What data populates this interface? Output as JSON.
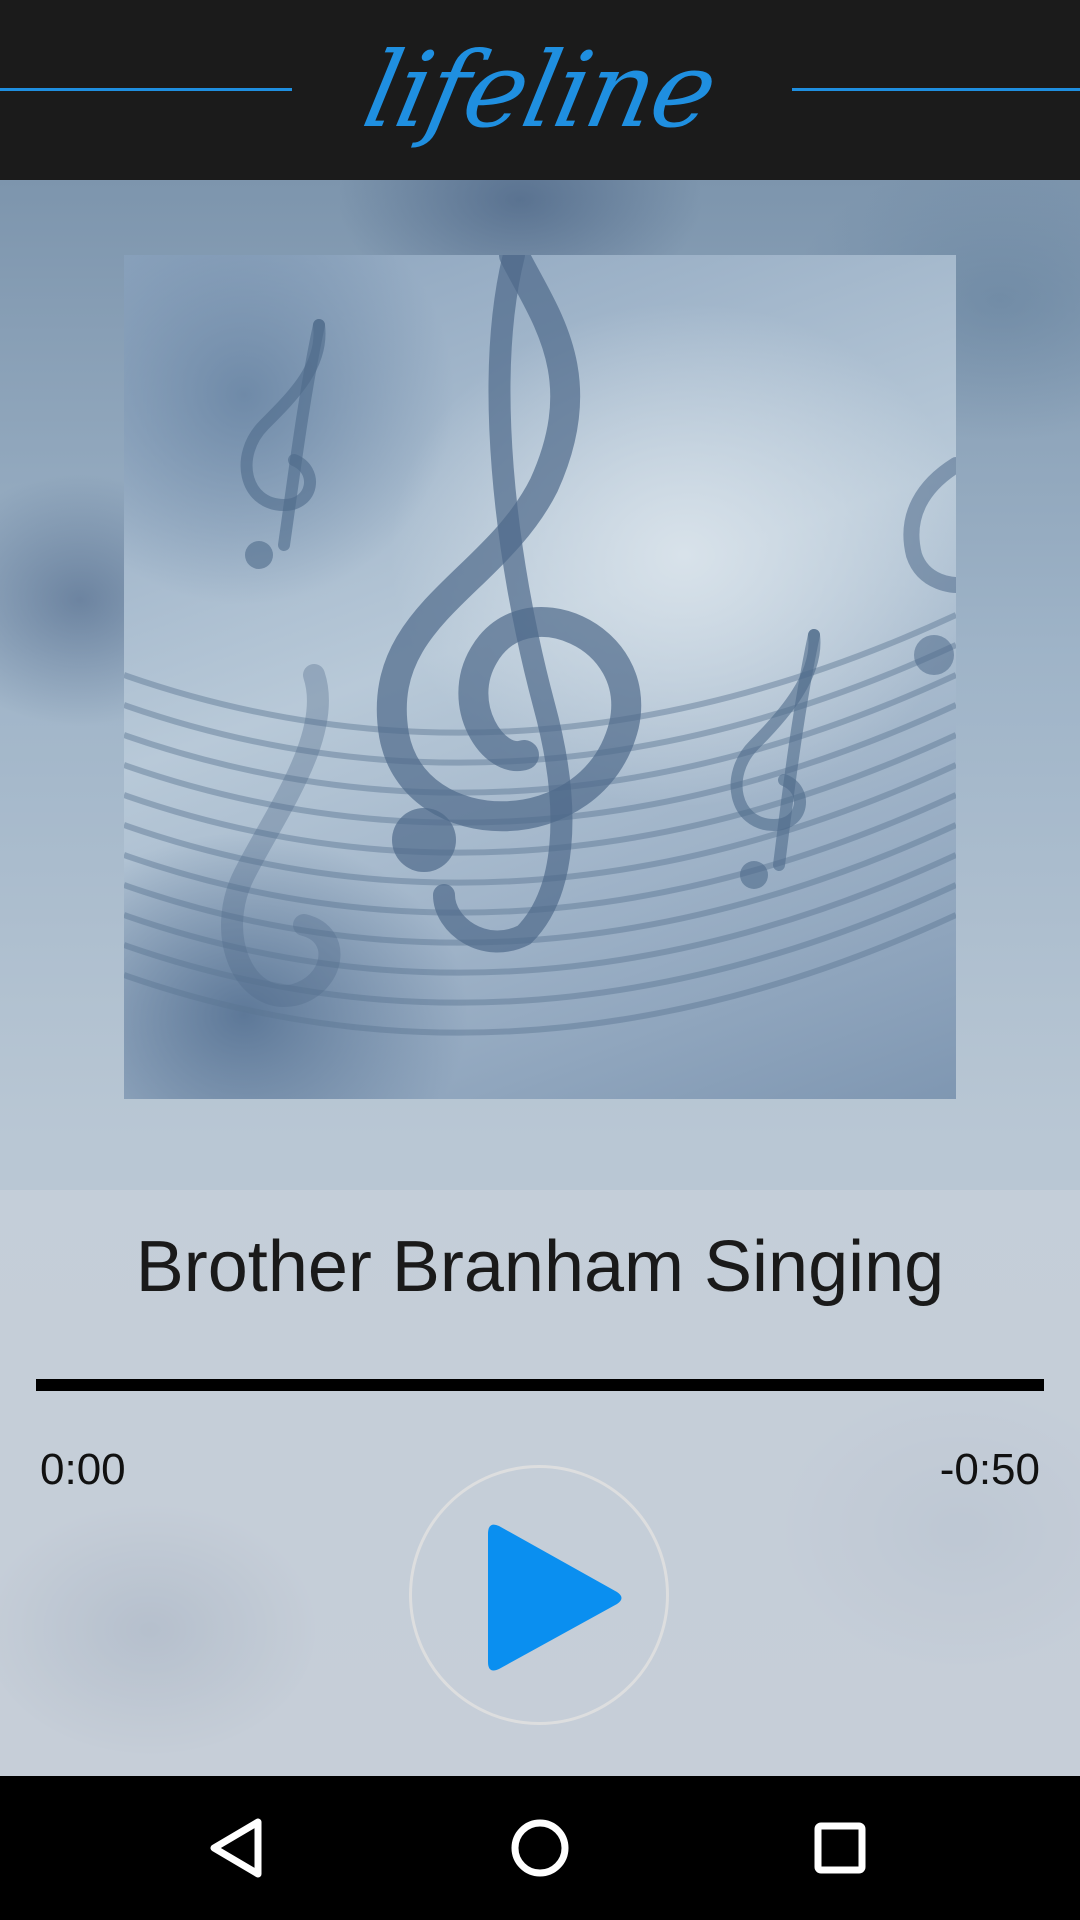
{
  "header": {
    "logo_text": "lifeline",
    "accent_color": "#1f8fe0"
  },
  "album": {
    "art_description_icon": "treble-clef-artwork"
  },
  "player": {
    "song_title": "Brother Branham Singing",
    "elapsed": "0:00",
    "remaining": "-0:50",
    "progress_fraction": 0,
    "play_icon": "play-icon",
    "play_color": "#0a8ff0"
  },
  "navbar": {
    "back_icon": "back-triangle-icon",
    "home_icon": "home-circle-icon",
    "recents_icon": "recents-square-icon"
  }
}
